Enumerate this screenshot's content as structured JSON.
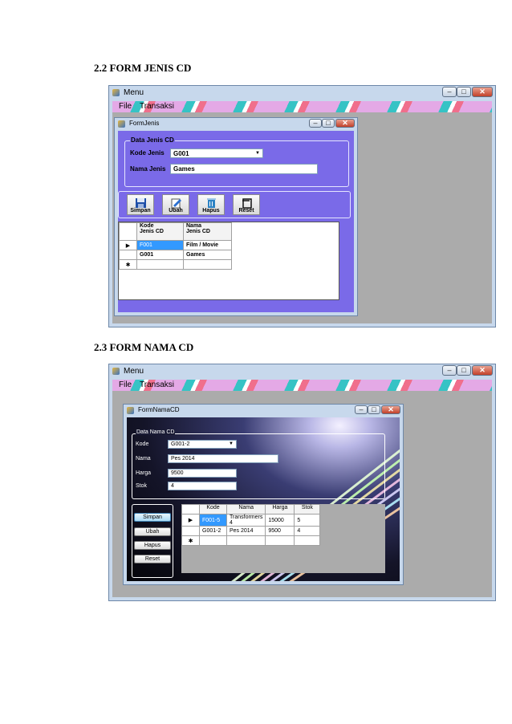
{
  "section1": {
    "heading": "2.2 FORM JENIS CD",
    "window": {
      "title": "Menu",
      "controls": {
        "minimize": "–",
        "maximize": "□",
        "close": "✕"
      },
      "menu": [
        "File",
        "Transaksi"
      ],
      "form": {
        "title": "FormJenis",
        "group_title": "Data Jenis CD",
        "kode_label": "Kode Jenis",
        "kode_value": "G001",
        "nama_label": "Nama Jenis",
        "nama_value": "Games",
        "buttons": [
          "Simpan",
          "Ubah",
          "Hapus",
          "Reset"
        ],
        "grid": {
          "headers": [
            "Kode\nJenis CD",
            "Nama\nJenis CD"
          ],
          "rows": [
            [
              "F001",
              "Film / Movie"
            ],
            [
              "G001",
              "Games"
            ]
          ]
        }
      }
    }
  },
  "section2": {
    "heading": "2.3 FORM NAMA CD",
    "window": {
      "title": "Menu",
      "menu": [
        "File",
        "Transaksi"
      ],
      "form": {
        "title": "FormNamaCD",
        "group_title": "Data Nama CD",
        "labels": [
          "Kode",
          "Nama",
          "Harga",
          "Stok"
        ],
        "values": [
          "G001-2",
          "Pes 2014",
          "9500",
          "4"
        ],
        "buttons": [
          "Simpan",
          "Ubah",
          "Hapus",
          "Reset"
        ],
        "grid": {
          "headers": [
            "Kode",
            "Nama",
            "Harga",
            "Stok"
          ],
          "rows": [
            [
              "F001-5",
              "Transformers 4",
              "15000",
              "5"
            ],
            [
              "G001-2",
              "Pes 2014",
              "9500",
              "4"
            ]
          ]
        }
      }
    }
  }
}
